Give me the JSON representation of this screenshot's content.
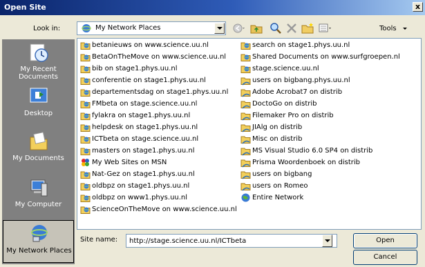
{
  "window": {
    "title": "Open Site",
    "close": "x"
  },
  "lookin": {
    "label": "Look in:",
    "value": "My Network Places"
  },
  "toolbar": {
    "tools_label": "Tools"
  },
  "places": [
    {
      "label": "My Recent Documents"
    },
    {
      "label": "Desktop"
    },
    {
      "label": "My Documents"
    },
    {
      "label": "My Computer"
    },
    {
      "label": "My Network Places"
    }
  ],
  "files_col1": [
    "betanieuws on www.science.uu.nl",
    "BetaOnTheMove on www.science.uu.nl",
    "bib on stage1.phys.uu.nl",
    "conferentie on stage1.phys.uu.nl",
    "departementsdag on stage1.phys.uu.nl",
    "FMbeta on stage.science.uu.nl",
    "fylakra on stage1.phys.uu.nl",
    "helpdesk on stage1.phys.uu.nl",
    "ICTbeta on stage.science.uu.nl",
    "masters on stage1.phys.uu.nl",
    "My Web Sites on MSN",
    "Nat-Gez on stage1.phys.uu.nl",
    "oldbpz on stage1.phys.uu.nl",
    "oldbpz on www1.phys.uu.nl",
    "ScienceOnTheMove on www.science.uu.nl"
  ],
  "files_col2": [
    "search on stage1.phys.uu.nl",
    "Shared Documents on www.surfgroepen.nl",
    "stage.science.uu.nl",
    "users on bigbang.phys.uu.nl",
    "Adobe Acrobat7 on distrib",
    "DoctoGo on distrib",
    "Filemaker Pro on distrib",
    "JIAlg on distrib",
    "Misc on distrib",
    "MS Visual Studio 6.0 SP4 on distrib",
    "Prisma Woordenboek on distrib",
    "users on bigbang",
    "users on Romeo",
    "Entire Network"
  ],
  "sitename": {
    "label": "Site name:",
    "value": "http://stage.science.uu.nl/ICTbeta"
  },
  "buttons": {
    "open": "Open",
    "cancel": "Cancel"
  },
  "colors": {
    "title_start": "#0a246a",
    "title_end": "#a6caf0",
    "dialog_bg": "#ece9d8",
    "places_bg": "#808080"
  }
}
